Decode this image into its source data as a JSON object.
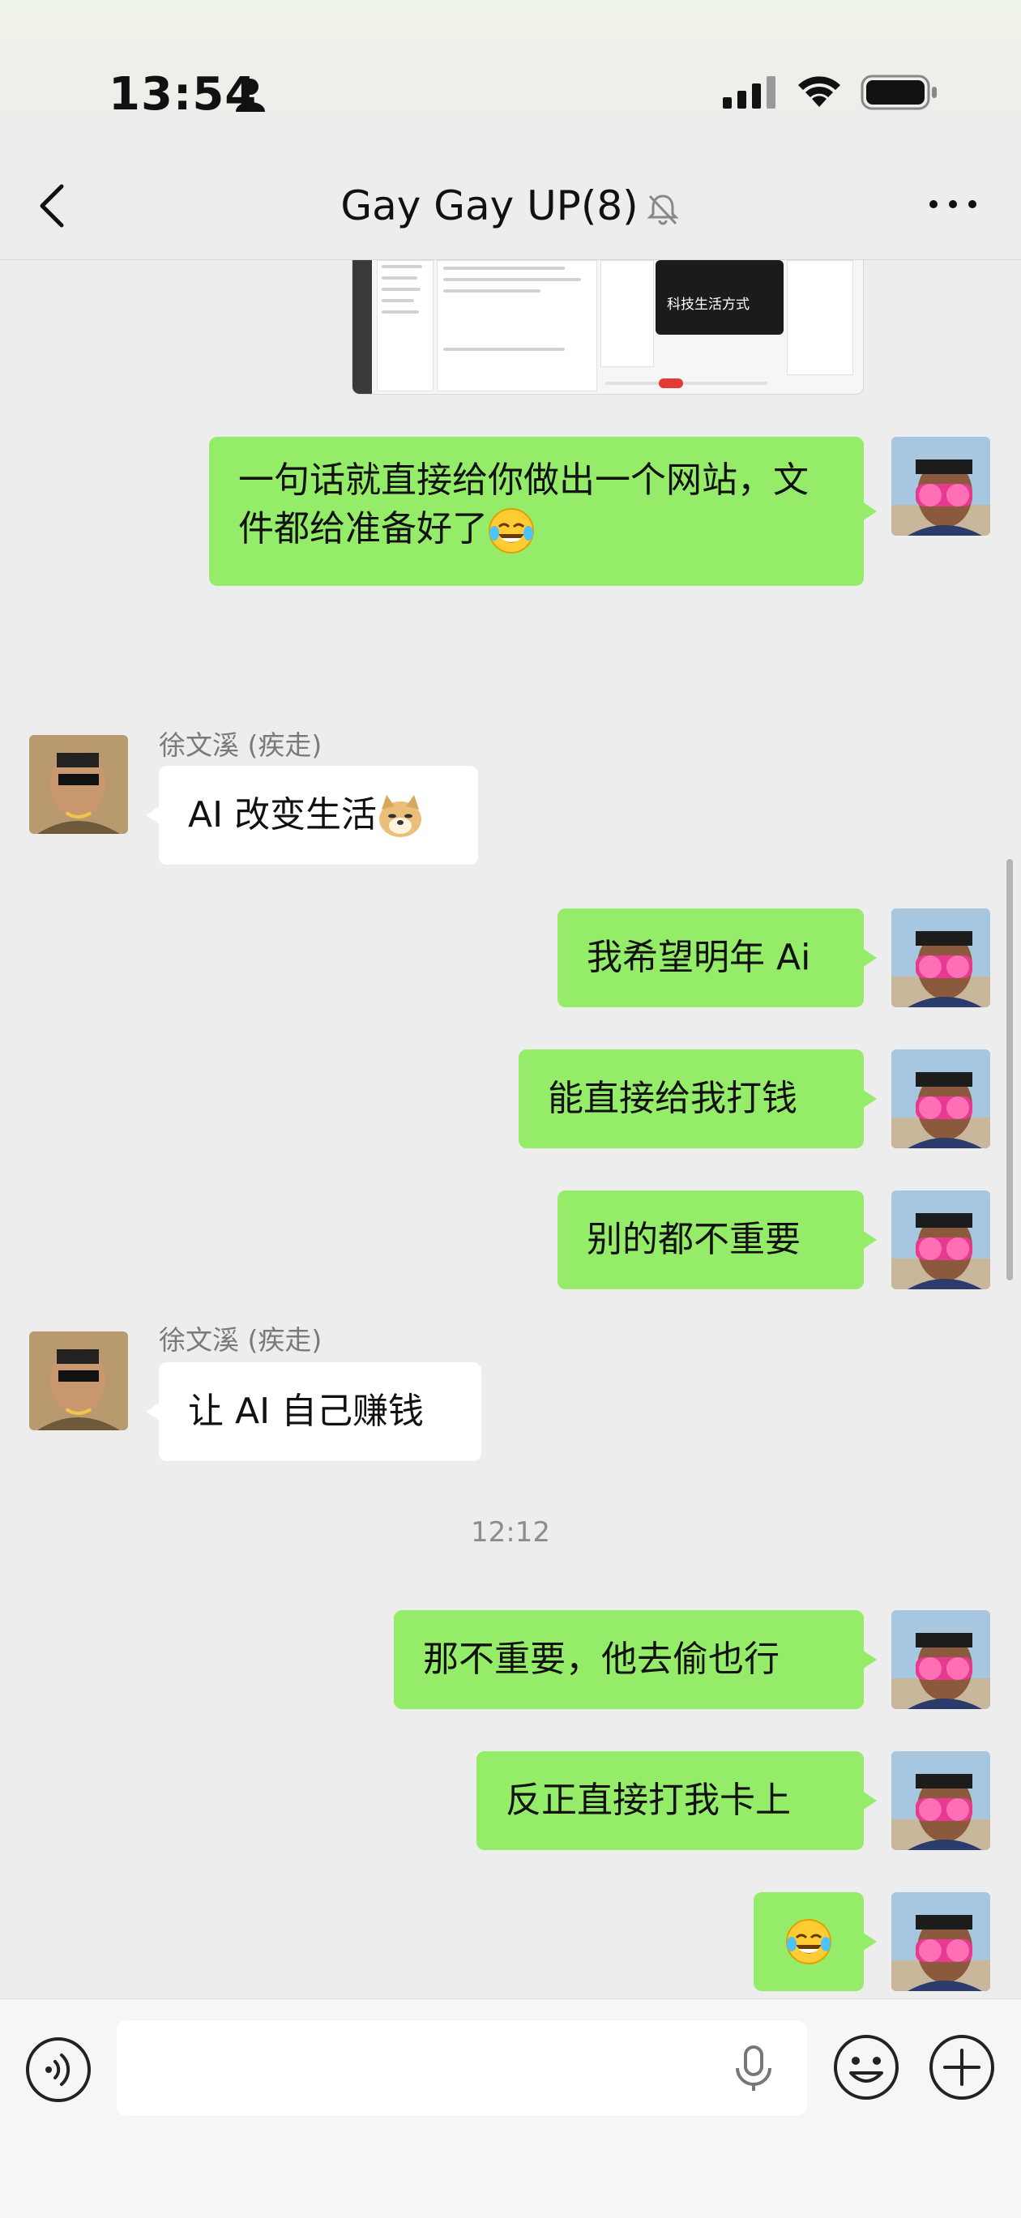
{
  "status": {
    "time": "13:54"
  },
  "nav": {
    "title": "Gay Gay UP(8)"
  },
  "preview": {
    "caption": "科技生活方式"
  },
  "messages": [
    {
      "side": "me",
      "text": "一句话就直接给你做出一个网站，文件都给准备好了",
      "emoji": "tears-of-joy"
    },
    {
      "side": "other",
      "sender": "徐文溪 (疾走)",
      "text": "AI 改变生活",
      "emoji": "doge"
    },
    {
      "side": "me",
      "text": "我希望明年 Ai"
    },
    {
      "side": "me",
      "text": "能直接给我打钱"
    },
    {
      "side": "me",
      "text": "别的都不重要"
    },
    {
      "side": "other",
      "sender": "徐文溪 (疾走)",
      "text": "让 AI 自己赚钱"
    },
    {
      "side": "me",
      "text": "那不重要，他去偷也行"
    },
    {
      "side": "me",
      "text": "反正直接打我卡上"
    },
    {
      "side": "me",
      "text": "",
      "emoji": "tears-of-joy"
    }
  ],
  "timestamp": "12:12",
  "input": {
    "value": "",
    "placeholder": ""
  },
  "colors": {
    "my_bubble": "#95ec69",
    "other_bubble": "#ffffff",
    "background": "#ededed"
  }
}
